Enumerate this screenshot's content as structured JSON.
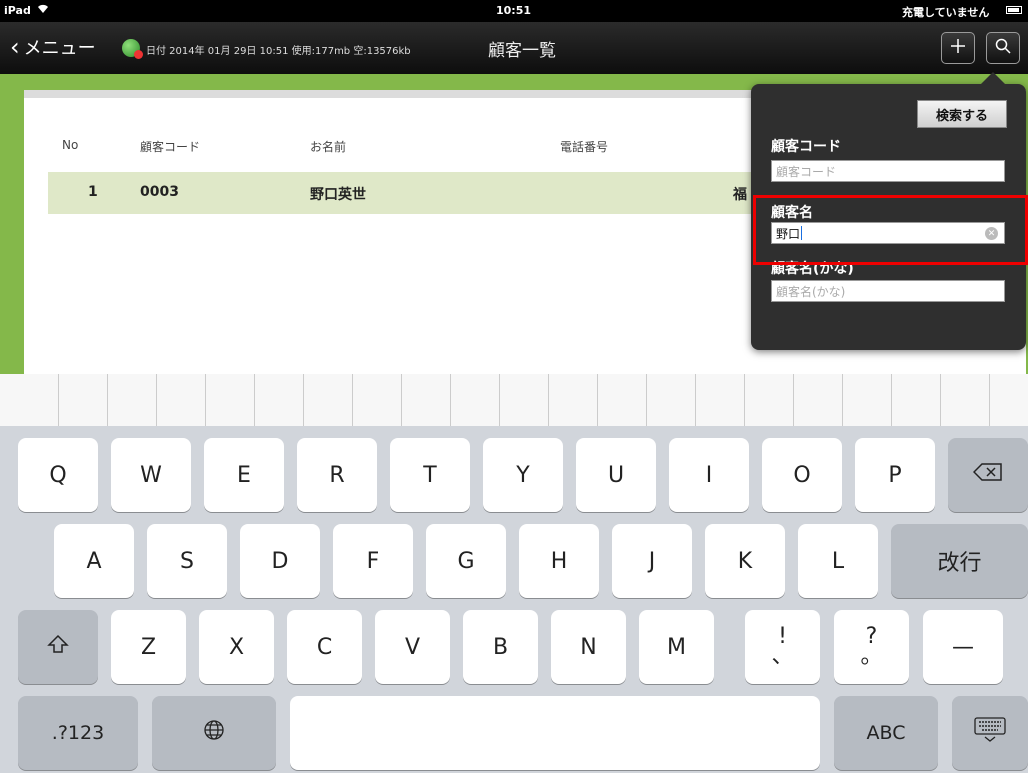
{
  "status": {
    "device": "iPad",
    "wifi_icon": "wifi-icon",
    "time": "10:51",
    "battery_text": "充電していません"
  },
  "nav": {
    "back_label": "メニュー",
    "info": "日付 2014年 01月 29日 10:51 使用:177mb 空:13576kb",
    "title": "顧客一覧",
    "add_icon": "plus-icon",
    "search_icon": "search-icon"
  },
  "table": {
    "headers": [
      "No",
      "顧客コード",
      "お名前",
      "電話番号"
    ],
    "rows": [
      {
        "no": "1",
        "code": "0003",
        "name": "野口英世",
        "extra": "福"
      }
    ]
  },
  "search_popover": {
    "button": "検索する",
    "fields": [
      {
        "label": "顧客コード",
        "value": "",
        "placeholder": "顧客コード"
      },
      {
        "label": "顧客名",
        "value": "野口",
        "placeholder": ""
      },
      {
        "label": "顧客名(かな)",
        "value": "",
        "placeholder": "顧客名(かな)"
      }
    ]
  },
  "keyboard": {
    "row1": [
      "Q",
      "W",
      "E",
      "R",
      "T",
      "Y",
      "U",
      "I",
      "O",
      "P"
    ],
    "row2": [
      "A",
      "S",
      "D",
      "F",
      "G",
      "H",
      "J",
      "K",
      "L"
    ],
    "return_label": "改行",
    "row3": [
      "Z",
      "X",
      "C",
      "V",
      "B",
      "N",
      "M"
    ],
    "punct1": [
      "!",
      "、"
    ],
    "punct2": [
      "?",
      "。"
    ],
    "dash": "—",
    "numbers_label": ".?123",
    "abc_label": "ABC",
    "colors": {
      "keyboard_bg": "#d1d5db",
      "highlight": "#e00000",
      "green": "#84b84a"
    }
  }
}
